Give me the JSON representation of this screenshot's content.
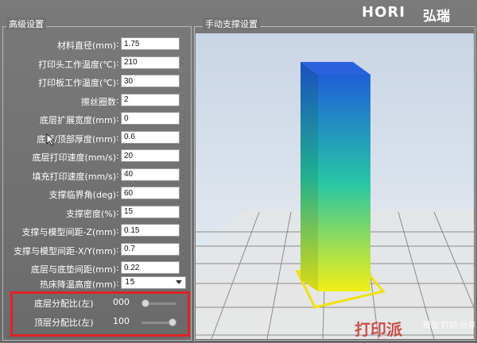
{
  "brand": {
    "logo_text": "HORI",
    "logo_cn": "弘瑞"
  },
  "watermark": {
    "main": "打印派",
    "sub": "模型 打印 分享"
  },
  "advanced": {
    "title": "高级设置",
    "fields": [
      {
        "label": "材料直径(mm)",
        "value": "1.75"
      },
      {
        "label": "打印头工作温度(℃)",
        "value": "210"
      },
      {
        "label": "打印板工作温度(℃)",
        "value": "30"
      },
      {
        "label": "擦丝圈数",
        "value": "2"
      },
      {
        "label": "底层扩展宽度(mm)",
        "value": "0"
      },
      {
        "label": "底部/顶部厚度(mm)",
        "value": "0.6"
      },
      {
        "label": "底层打印速度(mm/s)",
        "value": "20"
      },
      {
        "label": "填充打印速度(mm/s)",
        "value": "40"
      },
      {
        "label": "支撑临界角(deg)",
        "value": "60"
      },
      {
        "label": "支撑密度(%)",
        "value": "15"
      },
      {
        "label": "支撑与模型间距-Z(mm)",
        "value": "0.15"
      },
      {
        "label": "支撑与模型间距-X/Y(mm)",
        "value": "0.7"
      },
      {
        "label": "底层与底垫间距(mm)",
        "value": "0.22"
      }
    ],
    "cooling": {
      "label": "热床降温高度(mm)",
      "value": "15"
    },
    "sliders": [
      {
        "label": "底层分配比(左)",
        "value": "000",
        "ratio": 0.0
      },
      {
        "label": "顶层分配比(左)",
        "value": "100",
        "ratio": 1.0
      }
    ]
  },
  "support": {
    "title": "手动支撑设置"
  },
  "colors": {
    "model_top": "#1f5fd8",
    "model_mid": "#27c6a6",
    "model_bottom": "#f2ef17",
    "highlight": "#e22222"
  }
}
